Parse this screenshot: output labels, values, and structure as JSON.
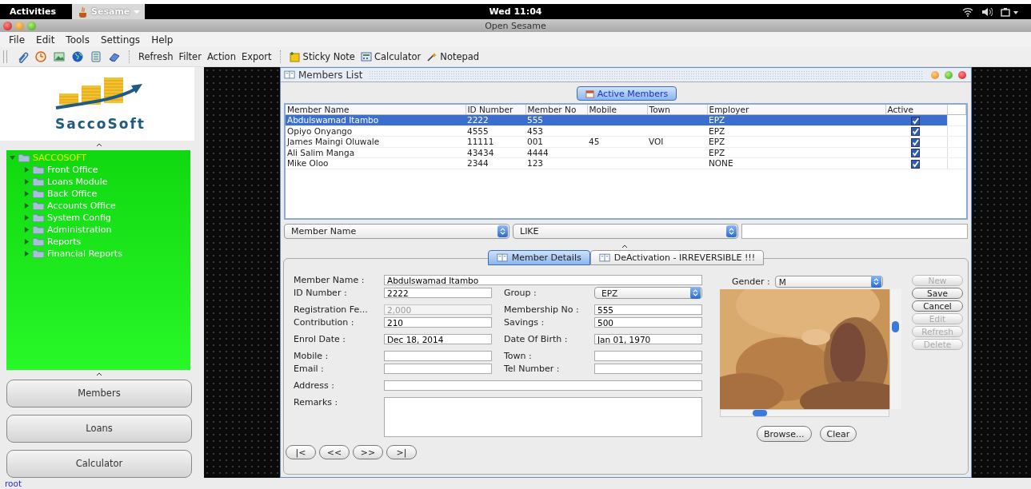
{
  "top_bar": {
    "activities": "Activities",
    "app_name": "Sesame",
    "clock": "Wed 11:04"
  },
  "window": {
    "title": "Open Sesame"
  },
  "menu": [
    "File",
    "Edit",
    "Tools",
    "Settings",
    "Help"
  ],
  "toolbar": {
    "text_buttons": [
      "Refresh",
      "Filter",
      "Action",
      "Export"
    ],
    "tools": [
      "Sticky Note",
      "Calculator",
      "Notepad"
    ]
  },
  "sidebar": {
    "logo_text": "SaccoSoft",
    "tree": {
      "label": "SACCOSOFT",
      "expanded": true,
      "children": [
        {
          "label": "Front Office",
          "expanded": false
        },
        {
          "label": "Loans Module",
          "expanded": false
        },
        {
          "label": "Back Office",
          "expanded": false
        },
        {
          "label": "Accounts Office",
          "expanded": false
        },
        {
          "label": "System Config",
          "expanded": false
        },
        {
          "label": "Administration",
          "expanded": false
        },
        {
          "label": "Reports",
          "expanded": false
        },
        {
          "label": "Financial Reports",
          "expanded": false
        }
      ]
    },
    "buttons": [
      "Members",
      "Loans",
      "Calculator"
    ]
  },
  "members_window": {
    "title": "Members List",
    "list_tab": "Active Members",
    "table": {
      "columns": [
        "Member Name",
        "ID Number",
        "Member No",
        "Mobile",
        "Town",
        "Employer",
        "Active"
      ],
      "rows": [
        {
          "cells": [
            "Abdulswamad Itambo",
            "2222",
            "555",
            "",
            "",
            "EPZ"
          ],
          "active": true,
          "selected": true
        },
        {
          "cells": [
            "Opiyo Onyango",
            "4555",
            "453",
            "",
            "",
            "EPZ"
          ],
          "active": true,
          "selected": false
        },
        {
          "cells": [
            "James Maingi Oluwale",
            "11111",
            "001",
            "45",
            "VOI",
            "EPZ"
          ],
          "active": true,
          "selected": false
        },
        {
          "cells": [
            "Ali Salim Manga",
            "43434",
            "4444",
            "",
            "",
            "EPZ"
          ],
          "active": true,
          "selected": false
        },
        {
          "cells": [
            "Mike Oloo",
            "2344",
            "123",
            "",
            "",
            "NONE"
          ],
          "active": true,
          "selected": false
        }
      ]
    },
    "filter": {
      "field": "Member Name",
      "operator": "LIKE"
    },
    "tabs": [
      {
        "label": "Member Details",
        "selected": true
      },
      {
        "label": "DeActivation - IRREVERSIBLE !!!",
        "selected": false
      }
    ],
    "form_sections": [
      [
        [
          {
            "label": "Member Name :",
            "value": "Abdulswamad Itambo",
            "kind": "wide",
            "disabled": false
          }
        ],
        [
          {
            "label": "ID Number :",
            "value": "2222",
            "kind": "text",
            "disabled": false
          },
          {
            "label": "Group  :",
            "value": "EPZ",
            "kind": "select"
          }
        ]
      ],
      [
        [
          {
            "label": "Registration Fe...",
            "value": "2,000",
            "kind": "text",
            "disabled": true
          },
          {
            "label": "Membership No :",
            "value": "555",
            "kind": "text",
            "disabled": false
          }
        ],
        [
          {
            "label": "Contribution :",
            "value": "210",
            "kind": "text",
            "disabled": false
          },
          {
            "label": "Savings :",
            "value": "500",
            "kind": "text",
            "disabled": false
          }
        ]
      ],
      [
        [
          {
            "label": "Enrol Date :",
            "value": "Dec 18, 2014",
            "kind": "text",
            "disabled": false
          },
          {
            "label": "Date Of Birth :",
            "value": "Jan 01, 1970",
            "kind": "text",
            "disabled": false
          }
        ]
      ],
      [
        [
          {
            "label": "Mobile :",
            "kind": "text",
            "disabled": false
          },
          {
            "label": "Town :",
            "kind": "text",
            "disabled": false
          }
        ],
        [
          {
            "label": "Email :",
            "kind": "text",
            "disabled": false
          },
          {
            "label": "Tel Number :",
            "kind": "text",
            "disabled": false
          }
        ]
      ],
      [
        [
          {
            "label": "Address :",
            "kind": "wide",
            "disabled": false
          }
        ]
      ],
      [
        [
          {
            "label": "Remarks :",
            "kind": "area"
          }
        ]
      ]
    ],
    "gender": {
      "label": "Gender :",
      "value": "M"
    },
    "photo_buttons": [
      "Browse...",
      "Clear"
    ],
    "actions": [
      {
        "label": "New",
        "disabled": true
      },
      {
        "label": "Save",
        "disabled": false
      },
      {
        "label": "Cancel",
        "disabled": false
      },
      {
        "label": "Edit",
        "disabled": true
      },
      {
        "label": "Refresh",
        "disabled": true
      },
      {
        "label": "Delete",
        "disabled": true
      }
    ],
    "nav_buttons": [
      "|<",
      "<<",
      ">>",
      ">|"
    ]
  },
  "status_bar": {
    "user": "root"
  }
}
